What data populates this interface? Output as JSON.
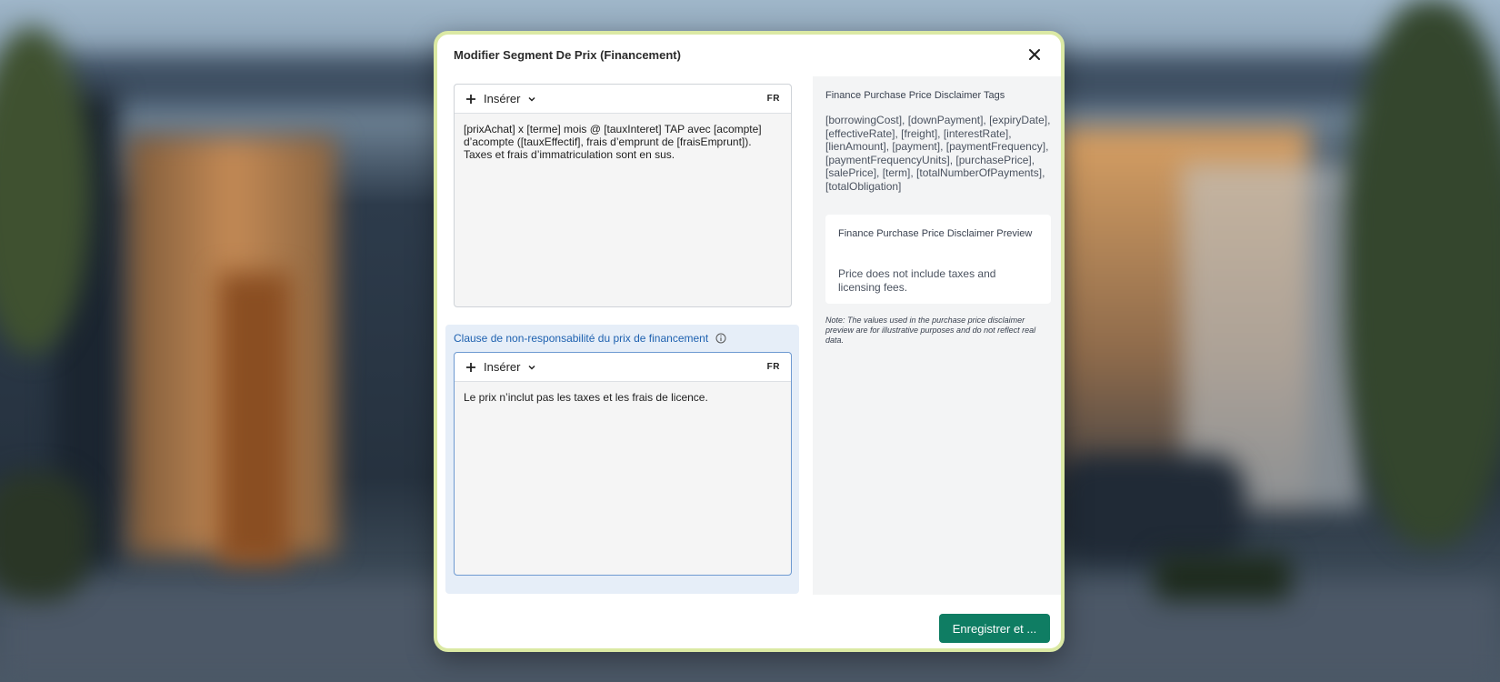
{
  "modal": {
    "title": "Modifier Segment De Prix (Financement)",
    "close_icon": "close-icon"
  },
  "editor1": {
    "insert_label": "Insérer",
    "lang": "FR",
    "content": "[prixAchat] x [terme] mois @ [tauxInteret] TAP avec [acompte] d’acompte ([tauxEffectif], frais d’emprunt de [fraisEmprunt]). Taxes et frais d’immatriculation sont en sus."
  },
  "disclaimer": {
    "label": "Clause de non-responsabilité du prix de financement",
    "info_icon": "info-icon",
    "insert_label": "Insérer",
    "lang": "FR",
    "content": "Le prix n’inclut pas les taxes et les frais de licence."
  },
  "side": {
    "title": "Finance Purchase Price Disclaimer Tags",
    "tags": "[borrowingCost], [downPayment], [expiryDate], [effectiveRate], [freight], [interestRate], [lienAmount], [payment], [paymentFrequency], [paymentFrequencyUnits], [purchasePrice], [salePrice], [term], [totalNumberOfPayments], [totalObligation]",
    "preview_title": "Finance Purchase Price Disclaimer Preview",
    "preview_text": "Price does not include taxes and licensing fees.",
    "note": "Note: The values used in the purchase price disclaimer preview are for illustrative purposes and do not reflect real data."
  },
  "footer": {
    "save_label": "Enregistrer et ..."
  },
  "colors": {
    "primary_button": "#0f7d63",
    "label_blue": "#1f62b0",
    "modal_border": "#dbe9a4"
  }
}
